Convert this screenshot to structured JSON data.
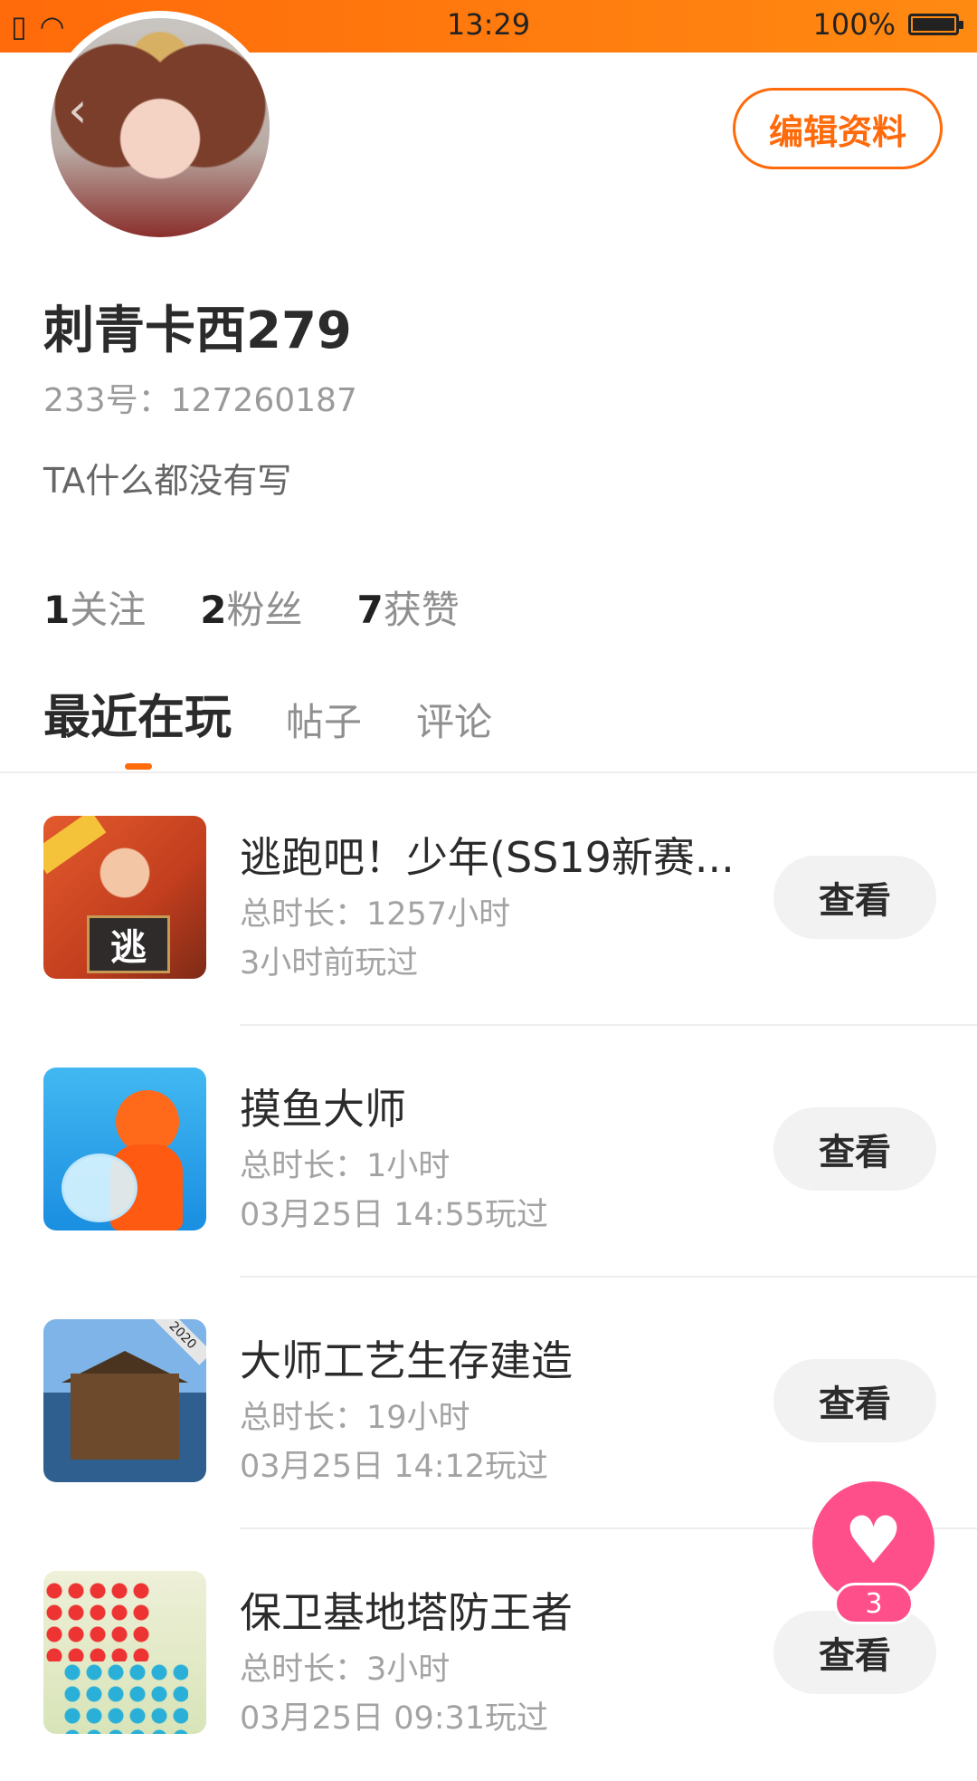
{
  "status_bar": {
    "time": "13:29",
    "battery": "100%"
  },
  "profile": {
    "edit_label": "编辑资料",
    "name": "刺青卡西279",
    "uid": "233号：127260187",
    "bio": "TA什么都没有写"
  },
  "stats": [
    {
      "count": "1",
      "label": "关注"
    },
    {
      "count": "2",
      "label": "粉丝"
    },
    {
      "count": "7",
      "label": "获赞"
    }
  ],
  "tabs": [
    {
      "label": "最近在玩",
      "active": true
    },
    {
      "label": "帖子",
      "active": false
    },
    {
      "label": "评论",
      "active": false
    }
  ],
  "games": [
    {
      "title": "逃跑吧！少年(SS19新赛...",
      "duration": "总时长：1257小时",
      "last_played": "3小时前玩过",
      "button": "查看",
      "icon_text": "逃"
    },
    {
      "title": "摸鱼大师",
      "duration": "总时长：1小时",
      "last_played": "03月25日 14:55玩过",
      "button": "查看"
    },
    {
      "title": "大师工艺生存建造",
      "duration": "总时长：19小时",
      "last_played": "03月25日 14:12玩过",
      "button": "查看",
      "icon_badge": "2020"
    },
    {
      "title": "保卫基地塔防王者",
      "duration": "总时长：3小时",
      "last_played": "03月25日 09:31玩过",
      "button": "查看"
    }
  ],
  "fab": {
    "count": "3"
  },
  "colors": {
    "accent": "#ff6a0a",
    "fab": "#ff4f8b"
  },
  "icons": [
    "sim-icon",
    "wifi-icon",
    "battery-icon",
    "back-arrow-icon",
    "heart-icon"
  ]
}
